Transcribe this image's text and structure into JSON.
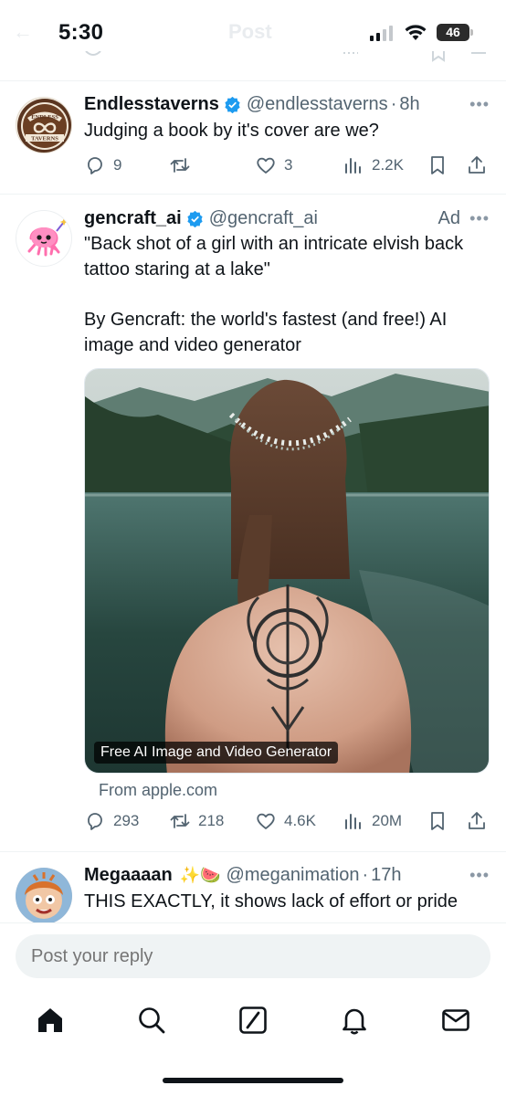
{
  "status_bar": {
    "time": "5:30",
    "battery": "46",
    "ghost_title": "Post"
  },
  "tweets": [
    {
      "name": "Endlesstaverns",
      "handle": "@endlesstaverns",
      "time": "8h",
      "text": "Judging a book by it's cover are we?",
      "logo_text_top": "ENDLESS",
      "logo_text_bottom": "TAVERNS",
      "replies": "9",
      "reposts": "",
      "likes": "3",
      "views": "2.2K"
    },
    {
      "name": "gencraft_ai",
      "handle": "@gencraft_ai",
      "ad_label": "Ad",
      "text_line1": "\"Back shot of a girl with an intricate elvish back tattoo staring at a lake\"",
      "text_line2": "By Gencraft: the world's fastest (and free!) AI image and video generator",
      "media_caption": "Free AI Image and Video Generator",
      "source": "From apple.com",
      "replies": "293",
      "reposts": "218",
      "likes": "4.6K",
      "views": "20M"
    },
    {
      "name": "Megaaaan",
      "name_emoji": "✨🍉",
      "handle": "@meganimation",
      "time": "17h",
      "text": "THIS EXACTLY, it shows lack of effort or pride"
    }
  ],
  "reply": {
    "placeholder": "Post your reply"
  },
  "colors": {
    "text": "#0f1419",
    "secondary": "#536471",
    "verified": "#1d9bf0",
    "divider": "#eff3f4"
  },
  "icons": [
    "reply-icon",
    "repost-icon",
    "like-icon",
    "views-icon",
    "bookmark-icon",
    "share-icon",
    "home-icon",
    "search-icon",
    "grok-icon",
    "notifications-icon",
    "messages-icon"
  ]
}
